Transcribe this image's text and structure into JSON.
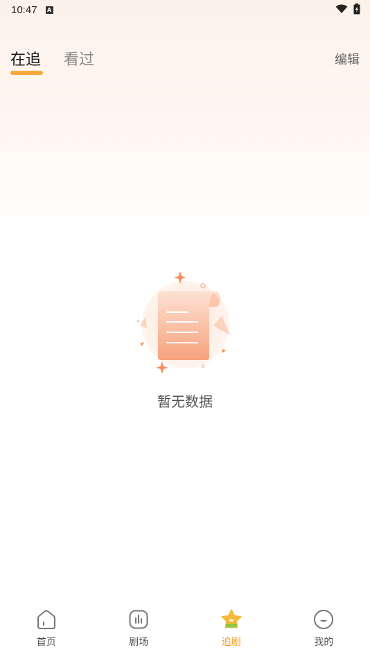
{
  "status_bar": {
    "time": "10:47",
    "notification_letter": "A"
  },
  "header": {
    "tabs": [
      {
        "label": "在追",
        "active": true
      },
      {
        "label": "看过",
        "active": false
      }
    ],
    "edit_label": "编辑"
  },
  "empty_state": {
    "icon": "empty-document-icon",
    "message": "暂无数据"
  },
  "bottom_nav": {
    "items": [
      {
        "label": "首页",
        "icon": "home-icon",
        "active": false
      },
      {
        "label": "剧场",
        "icon": "theater-icon",
        "active": false
      },
      {
        "label": "追剧",
        "icon": "star-icon",
        "active": true
      },
      {
        "label": "我的",
        "icon": "profile-icon",
        "active": false
      }
    ]
  },
  "colors": {
    "accent": "#f39a1e",
    "tab_underline": "#f7a93c",
    "illustration": "#f5a27c"
  }
}
